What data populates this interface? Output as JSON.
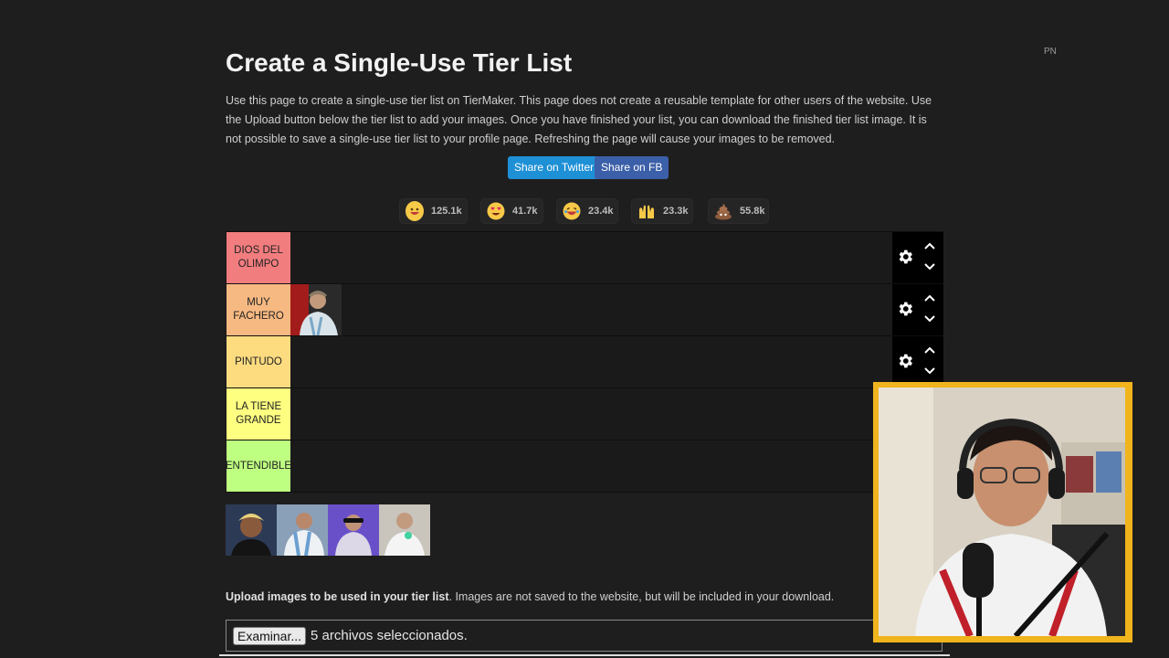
{
  "header": {
    "title": "Create a Single-Use Tier List",
    "badge": "PN",
    "description": "Use this page to create a single-use tier list on TierMaker. This page does not create a reusable template for other users of the website. Use the Upload button below the tier list to add your images. Once you have finished your list, you can download the finished tier list image. It is not possible to save a single-use tier list to your profile page. Refreshing the page will cause your images to be removed."
  },
  "share": {
    "twitter_label": "Share on Twitter",
    "facebook_label": "Share on FB"
  },
  "reactions": [
    {
      "icon": "grinning-face-icon",
      "count": "125.1k"
    },
    {
      "icon": "heart-eyes-icon",
      "count": "41.7k"
    },
    {
      "icon": "laughing-face-icon",
      "count": "23.4k"
    },
    {
      "icon": "raised-hands-icon",
      "count": "23.3k"
    },
    {
      "icon": "poop-icon",
      "count": "55.8k"
    }
  ],
  "tiers": [
    {
      "label": "DIOS DEL OLIMPO",
      "color": "#f27d7f",
      "items": 0
    },
    {
      "label": "MUY FACHERO",
      "color": "#f7b982",
      "items": 1
    },
    {
      "label": "PINTUDO",
      "color": "#fddc80",
      "items": 0
    },
    {
      "label": "LA TIENE GRANDE",
      "color": "#fefe80",
      "items": 0
    },
    {
      "label": "ENTENDIBLE",
      "color": "#befe80",
      "items": 0
    }
  ],
  "pool": {
    "items": 4
  },
  "upload": {
    "bold_text": "Upload images to be used in your tier list",
    "rest_text": ". Images are not saved to the website, but will be included in your download.",
    "button_label": "Examinar...",
    "status": "5 archivos seleccionados."
  },
  "colors": {
    "background": "#1f1e1f",
    "twitter": "#1e90d6",
    "facebook": "#3b5fa8",
    "webcam_frame": "#f0b41c"
  }
}
